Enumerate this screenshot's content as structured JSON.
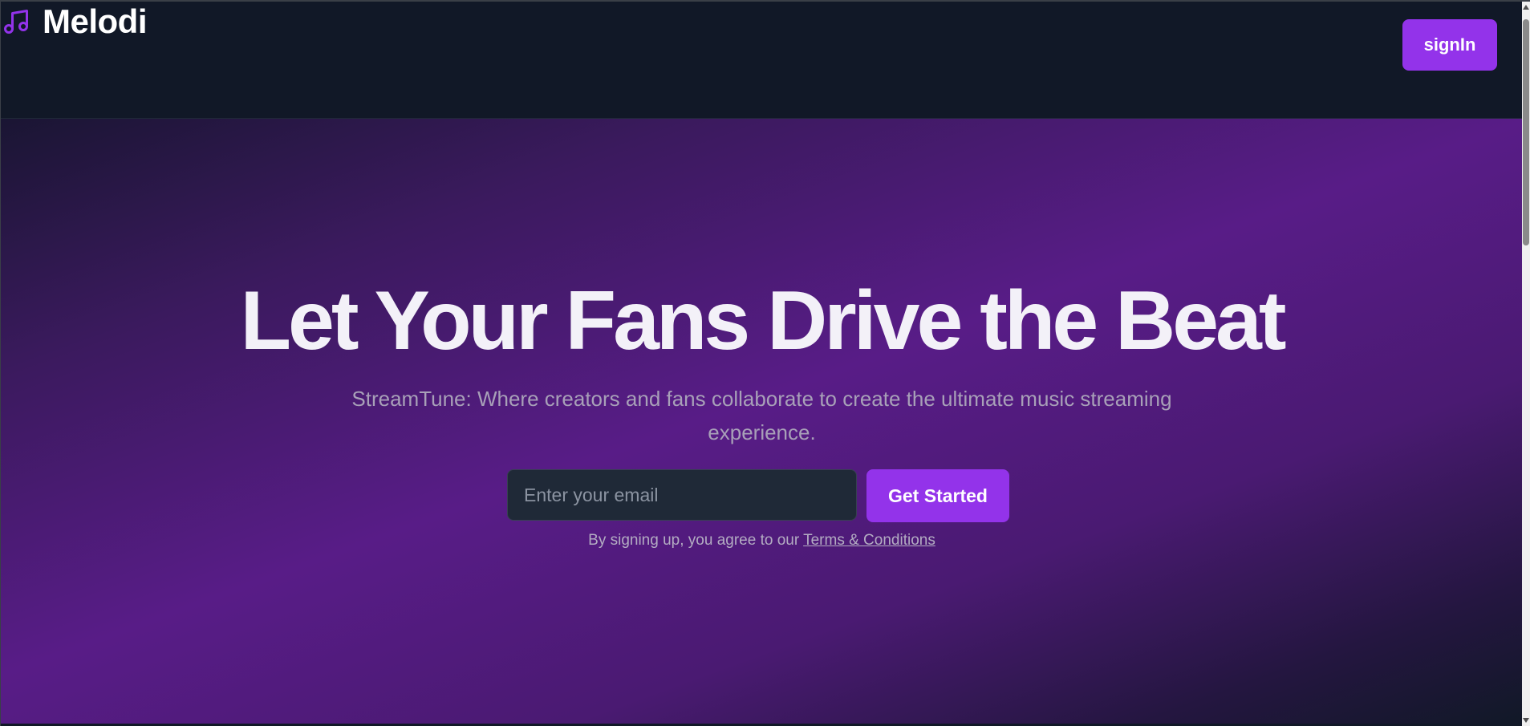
{
  "header": {
    "brand_name": "Melodi",
    "brand_icon": "music-note-icon",
    "signin_label": "signIn"
  },
  "hero": {
    "headline": "Let Your Fans Drive the Beat",
    "subtitle": "StreamTune: Where creators and fans collaborate to create the ultimate music streaming experience.",
    "email_placeholder": "Enter your email",
    "email_value": "",
    "cta_label": "Get Started",
    "terms_prefix": "By signing up, you agree to our ",
    "terms_link": "Terms & Conditions"
  },
  "colors": {
    "accent": "#9333ea",
    "header_bg": "#111827",
    "gradient_mid": "#581c87"
  }
}
